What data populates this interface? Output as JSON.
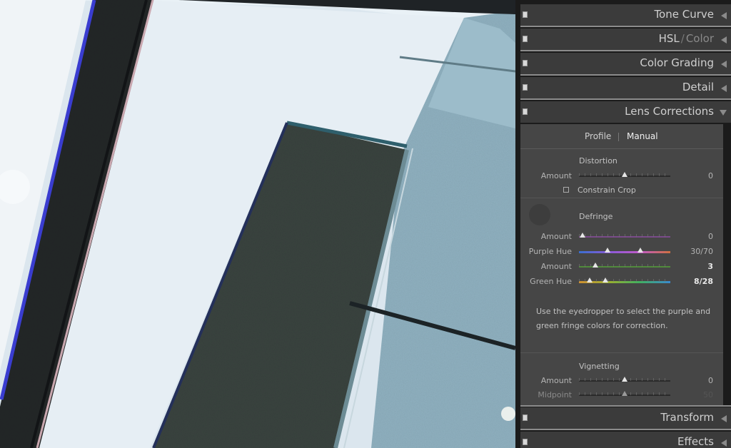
{
  "panel": {
    "headers": {
      "tone_curve": "Tone Curve",
      "hsl": "HSL",
      "hsl_sep": "/",
      "color": "Color",
      "color_grading": "Color Grading",
      "detail": "Detail",
      "lens_corrections": "Lens Corrections",
      "transform": "Transform",
      "effects": "Effects"
    },
    "lens": {
      "tabs": {
        "profile": "Profile",
        "manual": "Manual"
      },
      "distortion": {
        "title": "Distortion",
        "amount_label": "Amount",
        "amount_value": "0",
        "constrain_crop": "Constrain Crop"
      },
      "defringe": {
        "title": "Defringe",
        "purple_amount_label": "Amount",
        "purple_amount_value": "0",
        "purple_hue_label": "Purple Hue",
        "purple_hue_value": "30/70",
        "green_amount_label": "Amount",
        "green_amount_value": "3",
        "green_hue_label": "Green Hue",
        "green_hue_value": "8/28",
        "hint": "Use the eyedropper to select the purple and green fringe colors for correction."
      },
      "vignetting": {
        "title": "Vignetting",
        "amount_label": "Amount",
        "amount_value": "0",
        "midpoint_label": "Midpoint",
        "midpoint_value": "50"
      }
    }
  }
}
